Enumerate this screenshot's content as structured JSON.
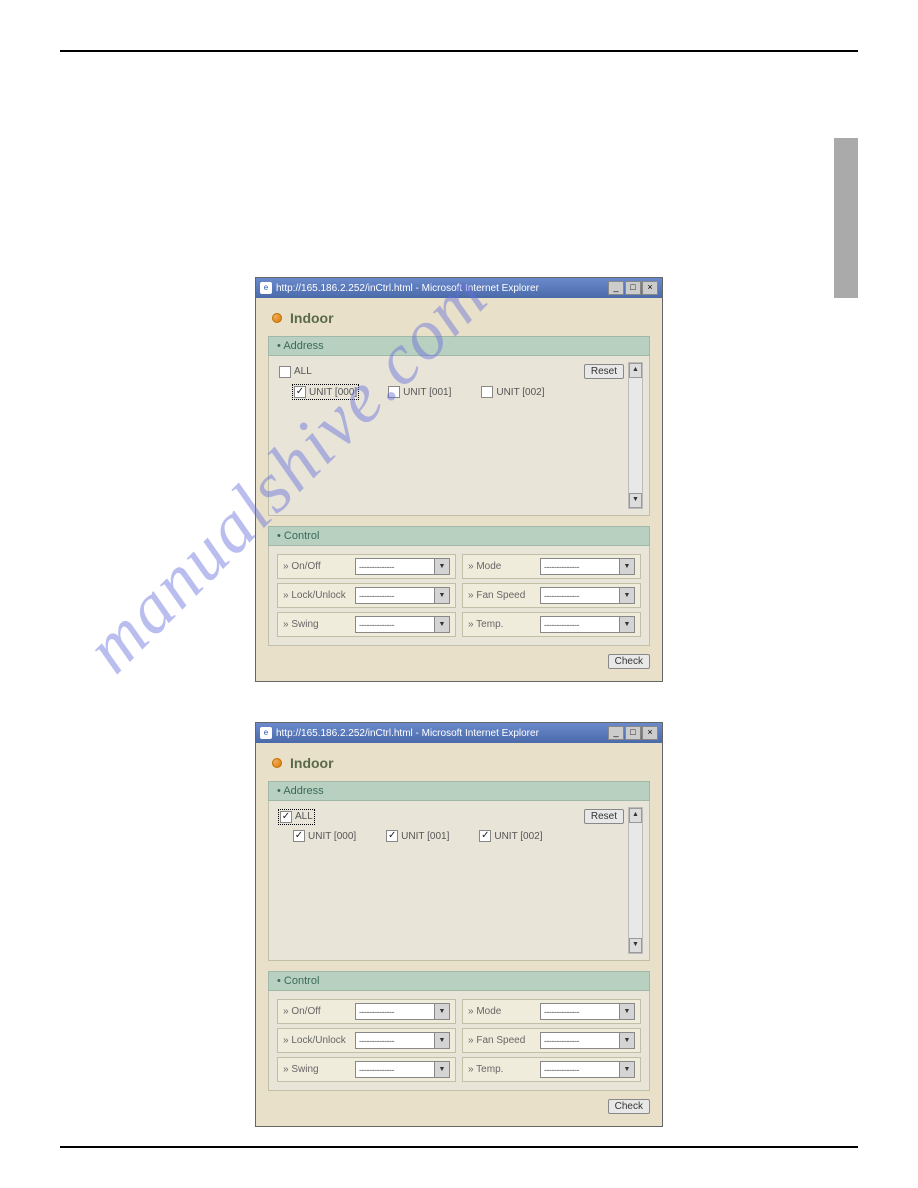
{
  "watermark": "manualshive.com",
  "windows": [
    {
      "titlebar": "http://165.186.2.252/inCtrl.html - Microsoft Internet Explorer",
      "title": "Indoor",
      "address_header": "Address",
      "all_label": "ALL",
      "all_checked": false,
      "all_focused": false,
      "reset_label": "Reset",
      "units": [
        {
          "label": "UNIT [000]",
          "checked": true,
          "focused": true
        },
        {
          "label": "UNIT [001]",
          "checked": false,
          "focused": false
        },
        {
          "label": "UNIT [002]",
          "checked": false,
          "focused": false
        }
      ],
      "control_header": "Control",
      "controls_left": [
        {
          "label": "On/Off",
          "value": "--------------"
        },
        {
          "label": "Lock/Unlock",
          "value": "--------------"
        },
        {
          "label": "Swing",
          "value": "--------------"
        }
      ],
      "controls_right": [
        {
          "label": "Mode",
          "value": "--------------"
        },
        {
          "label": "Fan Speed",
          "value": "--------------"
        },
        {
          "label": "Temp.",
          "value": "--------------"
        }
      ],
      "check_label": "Check"
    },
    {
      "titlebar": "http://165.186.2.252/inCtrl.html - Microsoft Internet Explorer",
      "title": "Indoor",
      "address_header": "Address",
      "all_label": "ALL",
      "all_checked": true,
      "all_focused": true,
      "reset_label": "Reset",
      "units": [
        {
          "label": "UNIT [000]",
          "checked": true,
          "focused": false
        },
        {
          "label": "UNIT [001]",
          "checked": true,
          "focused": false
        },
        {
          "label": "UNIT [002]",
          "checked": true,
          "focused": false
        }
      ],
      "control_header": "Control",
      "controls_left": [
        {
          "label": "On/Off",
          "value": "--------------"
        },
        {
          "label": "Lock/Unlock",
          "value": "--------------"
        },
        {
          "label": "Swing",
          "value": "--------------"
        }
      ],
      "controls_right": [
        {
          "label": "Mode",
          "value": "--------------"
        },
        {
          "label": "Fan Speed",
          "value": "--------------"
        },
        {
          "label": "Temp.",
          "value": "--------------"
        }
      ],
      "check_label": "Check"
    }
  ]
}
